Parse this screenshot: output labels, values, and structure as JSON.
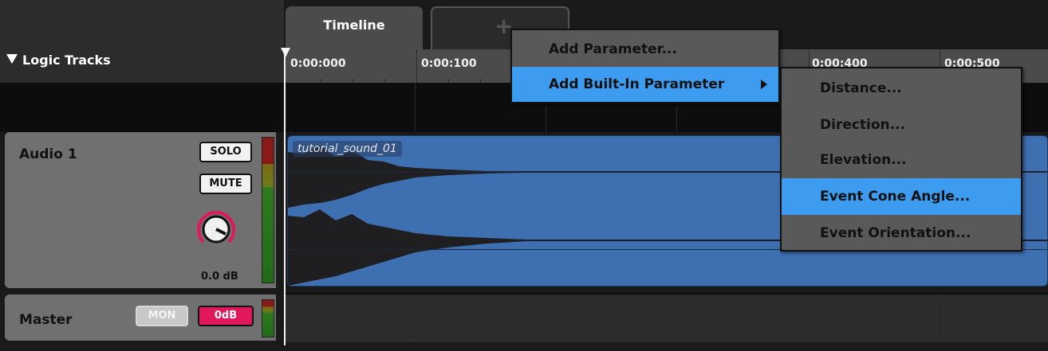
{
  "tracks_header": {
    "title": "Logic Tracks",
    "collapse_icon": "triangle-down-icon"
  },
  "tabs": [
    {
      "label": "Timeline",
      "active": true
    },
    {
      "label": "+",
      "icon": "plus-icon"
    }
  ],
  "ruler": {
    "ticks": [
      "0:00:000",
      "0:00:100",
      "0:00:400",
      "0:00:500"
    ]
  },
  "tracks": [
    {
      "name": "Audio 1",
      "solo_label": "SOLO",
      "mute_label": "MUTE",
      "volume_label": "0.0 dB",
      "region": {
        "label": "tutorial_sound_01",
        "color": "#3e6fb0"
      }
    }
  ],
  "master": {
    "name": "Master",
    "mon_label": "MON",
    "odb_label": "0dB",
    "odb_color": "#e0195c"
  },
  "context_menu": {
    "items": [
      {
        "label": "Add Parameter...",
        "selected": false
      },
      {
        "label": "Add Built-In Parameter",
        "selected": true,
        "submenu_icon": "chevron-right-icon"
      }
    ]
  },
  "submenu": {
    "items": [
      {
        "label": "Distance...",
        "selected": false
      },
      {
        "label": "Direction...",
        "selected": false
      },
      {
        "label": "Elevation...",
        "selected": false
      },
      {
        "label": "Event Cone Angle...",
        "selected": true
      },
      {
        "label": "Event Orientation...",
        "selected": false
      }
    ]
  },
  "colors": {
    "accent": "#3d9bf0",
    "knob_ring": "#e0195c"
  }
}
